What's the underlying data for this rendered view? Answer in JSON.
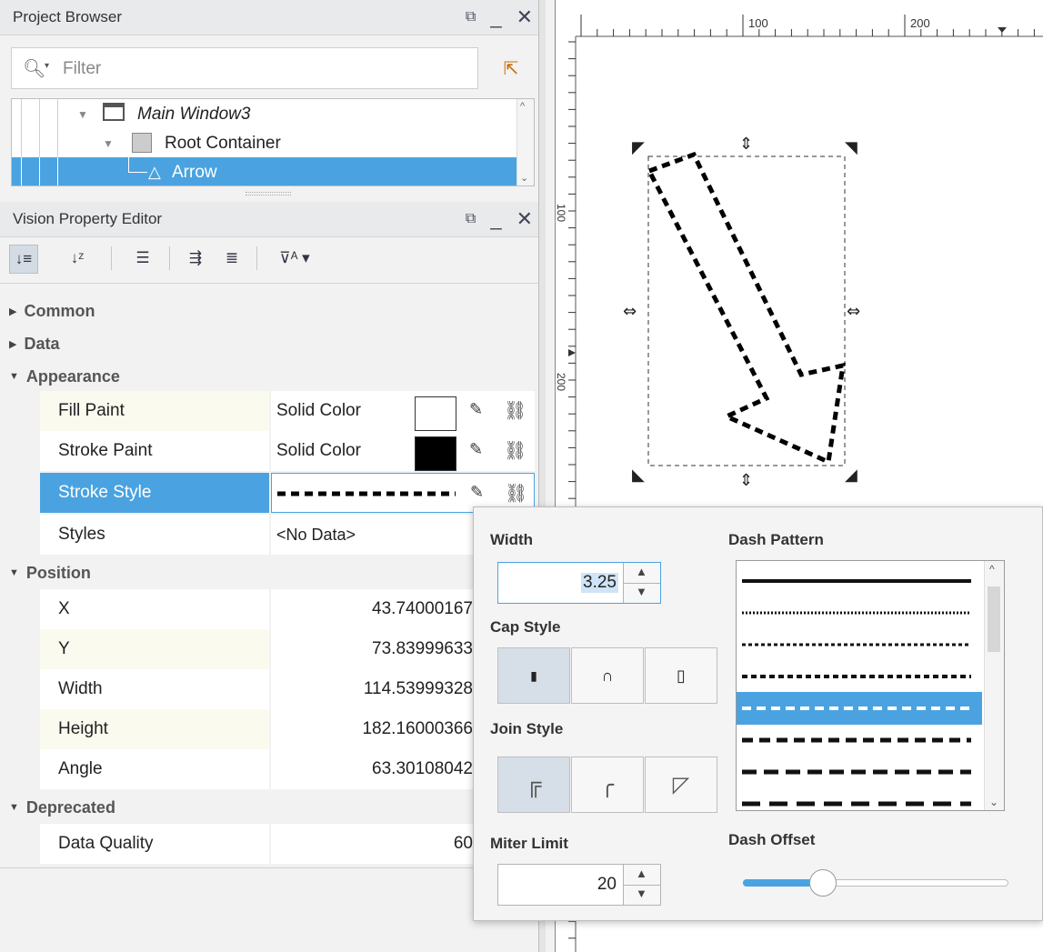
{
  "project_browser": {
    "title": "Project Browser",
    "filter_placeholder": "Filter",
    "tree": [
      {
        "label": "Main Window3"
      },
      {
        "label": "Root Container"
      },
      {
        "label": "Arrow"
      }
    ]
  },
  "property_editor": {
    "title": "Vision Property Editor",
    "categories": {
      "common": "Common",
      "data": "Data",
      "appearance": "Appearance",
      "position": "Position",
      "deprecated": "Deprecated"
    },
    "rows": {
      "fill_paint": {
        "name": "Fill Paint",
        "value": "Solid Color",
        "color": "#ffffff"
      },
      "stroke_paint": {
        "name": "Stroke Paint",
        "value": "Solid Color",
        "color": "#000000"
      },
      "stroke_style": {
        "name": "Stroke Style"
      },
      "styles": {
        "name": "Styles",
        "value": "<No Data>"
      },
      "x": {
        "name": "X",
        "value": "43.74000167"
      },
      "y": {
        "name": "Y",
        "value": "73.83999633"
      },
      "width": {
        "name": "Width",
        "value": "114.53999328"
      },
      "height": {
        "name": "Height",
        "value": "182.16000366"
      },
      "angle": {
        "name": "Angle",
        "value": "63.30108042"
      },
      "data_quality": {
        "name": "Data Quality",
        "value": "60"
      }
    }
  },
  "ruler": {
    "top_labels": [
      "100",
      "200"
    ],
    "left_labels": [
      "100",
      "200"
    ]
  },
  "stroke_popup": {
    "width_label": "Width",
    "width_value": "3.25",
    "cap_style_label": "Cap Style",
    "join_style_label": "Join Style",
    "miter_limit_label": "Miter Limit",
    "miter_limit_value": "20",
    "dash_pattern_label": "Dash Pattern",
    "dash_offset_label": "Dash Offset",
    "dash_offset_fraction": 0.3
  },
  "colors": {
    "accent": "#4aa3e0",
    "header_bg": "#e9eaec",
    "alt_row": "#fbfaef"
  }
}
